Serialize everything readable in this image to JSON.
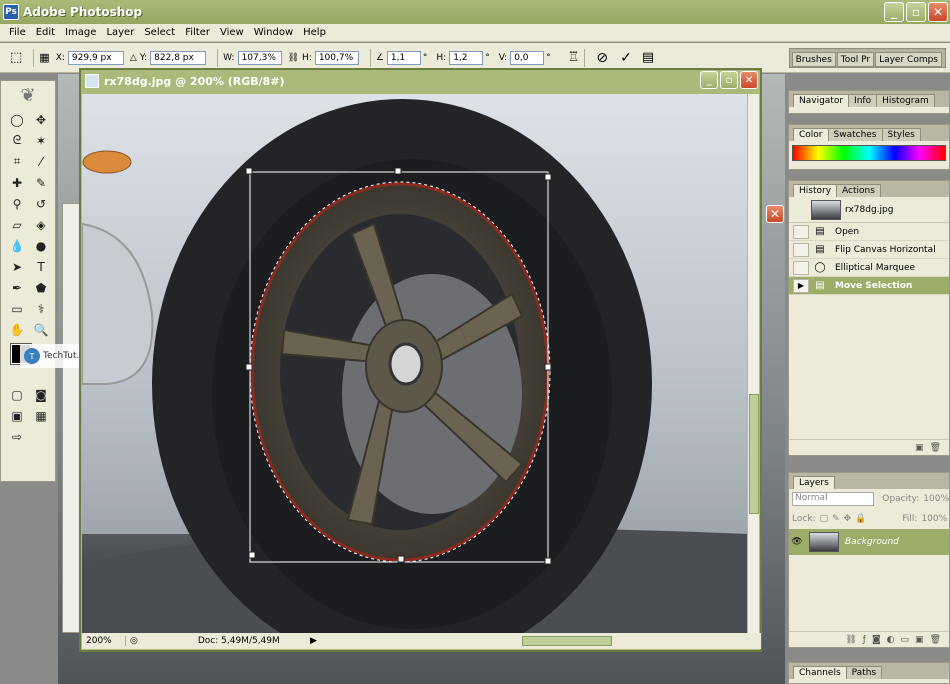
{
  "app": {
    "title": "Adobe Photoshop",
    "icon": "photoshop-icon"
  },
  "window_buttons": {
    "minimize": "_",
    "maximize": "▫",
    "close": "✕"
  },
  "menu": [
    "File",
    "Edit",
    "Image",
    "Layer",
    "Select",
    "Filter",
    "View",
    "Window",
    "Help"
  ],
  "options": {
    "x_label": "X:",
    "x_value": "929,9 px",
    "y_label": "Y:",
    "y_value": "822,8 px",
    "w_label": "W:",
    "w_value": "107,3%",
    "h_label": "H:",
    "h_value": "100,7%",
    "angle_value": "1,1",
    "hskew_label": "H:",
    "hskew_value": "1,2",
    "vskew_label": "V:",
    "vskew_value": "0,0"
  },
  "tray_tabs": [
    "Brushes",
    "Tool Pr",
    "Layer Comps"
  ],
  "document": {
    "title": "rx78dg.jpg @ 200% (RGB/8#)",
    "zoom": "200%",
    "doc_size": "Doc: 5,49M/5,49M"
  },
  "navigator_tabs": [
    "Navigator",
    "Info",
    "Histogram"
  ],
  "color_tabs": [
    "Color",
    "Swatches",
    "Styles"
  ],
  "history_tabs": [
    "History",
    "Actions"
  ],
  "history": {
    "snapshot": "rx78dg.jpg",
    "items": [
      {
        "label": "Open",
        "icon": "document-icon"
      },
      {
        "label": "Flip Canvas Horizontal",
        "icon": "document-icon"
      },
      {
        "label": "Elliptical Marquee",
        "icon": "ellipse-icon"
      },
      {
        "label": "Move Selection",
        "icon": "document-icon"
      }
    ]
  },
  "layers_tabs": [
    "Layers"
  ],
  "layers": {
    "blend_mode": "Normal",
    "opacity_label": "Opacity:",
    "opacity_value": "100%",
    "lock_label": "Lock:",
    "fill_label": "Fill:",
    "fill_value": "100%",
    "layer_name": "Background"
  },
  "channels_tabs": [
    "Channels",
    "Paths"
  ],
  "watermark": "TechTut.com"
}
